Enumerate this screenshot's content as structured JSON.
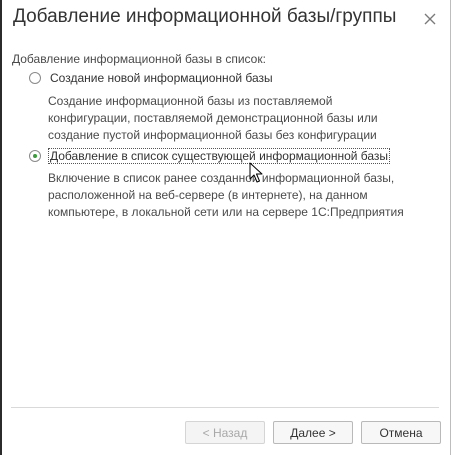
{
  "dialog": {
    "title": "Добавление информационной базы/группы",
    "close_icon": "close-icon"
  },
  "section_label": "Добавление информационной базы в список:",
  "options": [
    {
      "label": "Создание новой информационной базы",
      "selected": false,
      "description": [
        "Создание информационной базы из поставляемой",
        "конфигурации, поставляемой демонстрационной базы или",
        "создание пустой информационной базы без конфигурации"
      ]
    },
    {
      "label": "Добавление в список существующей информационной базы",
      "selected": true,
      "description": [
        "Включение в список ранее созданной информационной базы,",
        "расположенной на веб-сервере (в интернете), на данном",
        "компьютере,  в локальной сети или на сервере 1С:Предприятия"
      ]
    }
  ],
  "buttons": {
    "back": "< Назад",
    "next": "Далее >",
    "cancel": "Отмена"
  },
  "colors": {
    "radio_selected": "#3a9c3a"
  }
}
